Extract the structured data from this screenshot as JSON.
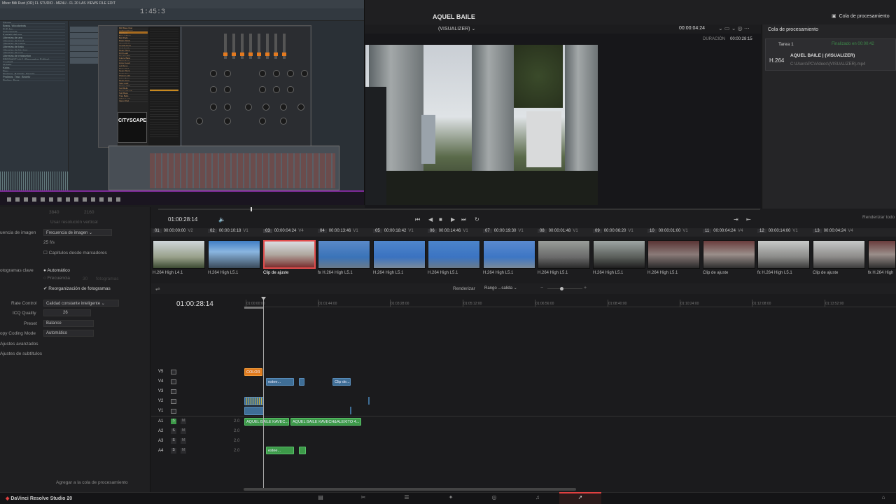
{
  "fl_studio": {
    "title": "Mixer Billi Rust (OR) FL STUDIO - MENU - FL 20 LAS VIEWS FILE EDIT",
    "clock": "1:45:3",
    "browser_items": [
      "Slicers",
      "Brass, Woodwinds",
      "FLE Arp",
      "Instruments",
      "Kontakt del sus",
      "Librerías de arp",
      "Librerías de beat",
      "Librerías de nakor",
      "Librerías de bajo",
      "Librerías de hip hop",
      "Librerías de pop",
      "Librerías de reggaeton",
      "FRESHKIT Vol.1 (Reggaeton Edition)",
      "Cowbell",
      "Hi hats",
      "Kicks",
      "Perc",
      "Prolings_Balantic_Bnonly",
      "Prolings_Trap_Bnonly",
      "Proling_Bass"
    ],
    "plugin_name": "CITYSCAPE",
    "plugin_list": [
      "808 Bass Mod",
      "Ambient Drops",
      "Arp Keys",
      "Bass Gliders",
      "Bell Pads",
      "Brass Stack",
      "Chord Pads",
      "Crystal Keys",
      "Dark Synth",
      "Deep Pluck",
      "Drift Lead",
      "Electric Pad",
      "Future Bass",
      "Glass Keys",
      "Hyper Lead",
      "Lofi Keys",
      "Metro Pad",
      "Neon Pluck",
      "Night Drive",
      "Phase Lead",
      "Pulse Bass",
      "Retro Keys",
      "Saw Lead",
      "Skyline Pad",
      "Soft Bells",
      "Space Chords",
      "Sub Bass",
      "Trap Bells",
      "Urban Lead",
      "Vapor Pad"
    ]
  },
  "header": {
    "project_title": "AQUEL BAILE",
    "timeline_name": "(VISUALIZER)",
    "timecode": "00:00:04:24",
    "duration_label": "DURACIÓN",
    "duration_value": "00:00:28:15",
    "queue_button": "Cola de procesamiento"
  },
  "render_queue": {
    "title": "Cola de procesamiento",
    "job_name": "Tarea 1",
    "job_status": "Finalizado en 00:00:42",
    "job_format": "H.264",
    "job_title": "AQUEL BAILE | (VISUALIZER)",
    "job_path": "C:\\Users\\PC\\Videos\\(VISUALIZER).mp4",
    "render_all": "Renderizar todo"
  },
  "transport": {
    "timecode": "01:00:28:14"
  },
  "clips": [
    {
      "num": "01",
      "tc": "00:00:00:00",
      "track": "V2",
      "label": "H.264 High L4.1",
      "fx": false
    },
    {
      "num": "02",
      "tc": "00:00:10:18",
      "track": "V1",
      "label": "H.264 High L5.1",
      "fx": false
    },
    {
      "num": "03",
      "tc": "00:00:04:24",
      "track": "V4",
      "label": "Clip de ajuste",
      "fx": false
    },
    {
      "num": "04",
      "tc": "00:00:13:46",
      "track": "V1",
      "label": "H.264 High L5.1",
      "fx": true
    },
    {
      "num": "05",
      "tc": "00:00:18:42",
      "track": "V1",
      "label": "H.264 High L5.1",
      "fx": false
    },
    {
      "num": "06",
      "tc": "00:00:14:46",
      "track": "V1",
      "label": "H.264 High L5.1",
      "fx": false
    },
    {
      "num": "07",
      "tc": "00:00:19:30",
      "track": "V1",
      "label": "H.264 High L5.1",
      "fx": false
    },
    {
      "num": "08",
      "tc": "00:00:01:48",
      "track": "V1",
      "label": "H.264 High L5.1",
      "fx": false
    },
    {
      "num": "09",
      "tc": "00:00:06:20",
      "track": "V1",
      "label": "H.264 High L5.1",
      "fx": false
    },
    {
      "num": "10",
      "tc": "00:00:01:00",
      "track": "V1",
      "label": "H.264 High L5.1",
      "fx": false
    },
    {
      "num": "11",
      "tc": "00:00:04:24",
      "track": "V4",
      "label": "Clip de ajuste",
      "fx": false
    },
    {
      "num": "12",
      "tc": "00:00:14:00",
      "track": "V1",
      "label": "H.264 High L5.1",
      "fx": true
    },
    {
      "num": "13",
      "tc": "00:00:04:24",
      "track": "V4",
      "label": "Clip de ajuste",
      "fx": false
    },
    {
      "num": "",
      "tc": "",
      "track": "",
      "label": "H.264 High",
      "fx": true
    }
  ],
  "settings": {
    "res1": "3840",
    "res2": "2160",
    "use_resolution": "Usar resolución vertical",
    "frame_rate_label": "uencia de imagen",
    "frame_rate_value": "Frecuencia de imagen",
    "fps": "25 f/s",
    "chapters": "Capítulos desde marcadores",
    "keyframes_label": "otogramas clave",
    "keyframes_auto": "Automático",
    "keyframes_freq": "Frecuencia",
    "keyframes_freq_val": "30",
    "keyframes_unit": "fotogramas",
    "reorder": "Reorganización de fotogramas",
    "rate_control_label": "Rate Control",
    "rate_control_value": "Calidad constante inteligente",
    "icq_label": "ICQ Quality",
    "icq_value": "26",
    "preset_label": "Preset",
    "preset_value": "Balance",
    "copy_label": "opy Coding Mode",
    "copy_value": "Automático",
    "advanced": "Ajustes avanzados",
    "subtitles": "Ajustes de subtítulos",
    "add_queue": "Agregar a la cola de procesamiento"
  },
  "timeline": {
    "timecode": "01:00:28:14",
    "render_label": "Renderizar",
    "range_value": "Rango ...salida",
    "ticks": [
      "01:00:00:00",
      "01:01:44:00",
      "01:03:28:00",
      "01:05:12:00",
      "01:06:56:00",
      "01:08:40:00",
      "01:10:24:00",
      "01:12:08:00",
      "01:13:52:00"
    ],
    "video_tracks": [
      "V5",
      "V4",
      "V3",
      "V2",
      "V1"
    ],
    "audio_tracks": [
      "A1",
      "A2",
      "A3",
      "A4"
    ],
    "audio_vol": "2.0",
    "color_clip": "COLOR",
    "v4_clip1": "estee...",
    "v4_clip2": "Clip de...",
    "a1_clip1": "AQUEL BAILE KAVEC...",
    "a1_clip2": "AQUEL BAILE KAVECH&ALEXITO 4...",
    "a4_clip": "estee..."
  },
  "app": {
    "name": "DaVinci Resolve Studio 20"
  }
}
